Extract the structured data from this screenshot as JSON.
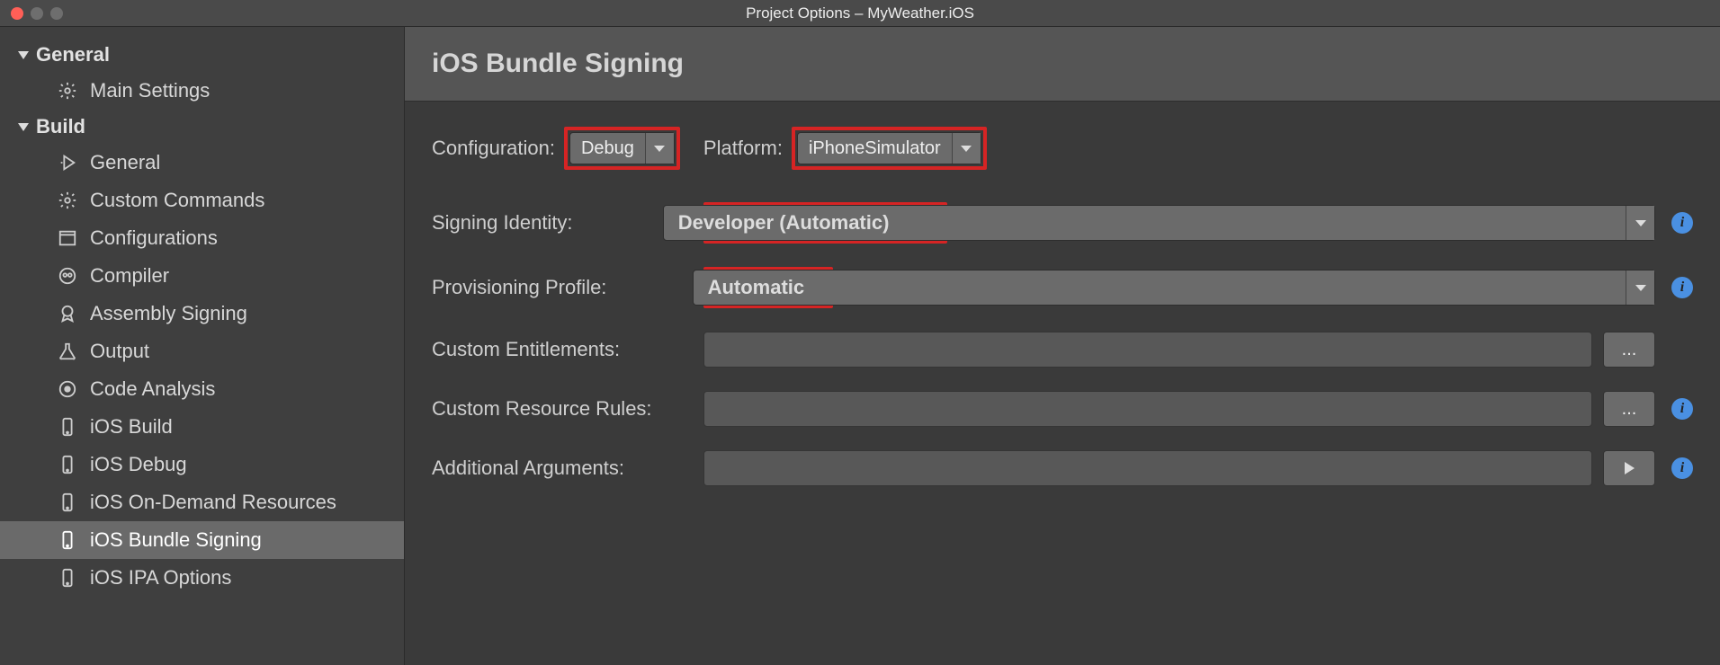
{
  "window": {
    "title": "Project Options – MyWeather.iOS"
  },
  "sidebar": {
    "sections": [
      {
        "label": "General",
        "items": [
          {
            "label": "Main Settings"
          }
        ]
      },
      {
        "label": "Build",
        "items": [
          {
            "label": "General"
          },
          {
            "label": "Custom Commands"
          },
          {
            "label": "Configurations"
          },
          {
            "label": "Compiler"
          },
          {
            "label": "Assembly Signing"
          },
          {
            "label": "Output"
          },
          {
            "label": "Code Analysis"
          },
          {
            "label": "iOS Build"
          },
          {
            "label": "iOS Debug"
          },
          {
            "label": "iOS On-Demand Resources"
          },
          {
            "label": "iOS Bundle Signing"
          },
          {
            "label": "iOS IPA Options"
          }
        ]
      }
    ]
  },
  "main": {
    "title": "iOS Bundle Signing",
    "configuration_label": "Configuration:",
    "configuration_value": "Debug",
    "platform_label": "Platform:",
    "platform_value": "iPhoneSimulator",
    "signing_identity_label": "Signing Identity:",
    "signing_identity_value": "Developer (Automatic)",
    "provisioning_profile_label": "Provisioning Profile:",
    "provisioning_profile_value": "Automatic",
    "custom_entitlements_label": "Custom Entitlements:",
    "custom_entitlements_value": "",
    "custom_resource_rules_label": "Custom Resource Rules:",
    "custom_resource_rules_value": "",
    "additional_arguments_label": "Additional Arguments:",
    "additional_arguments_value": "",
    "browse_btn": "...",
    "info_glyph": "i"
  }
}
